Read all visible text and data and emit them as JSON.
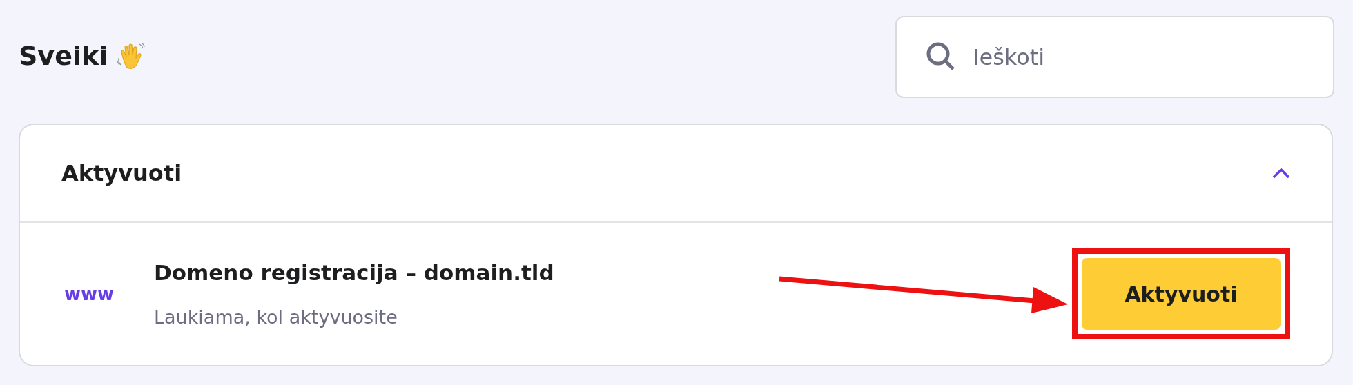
{
  "greeting": "Sveiki",
  "search": {
    "placeholder": "Ieškoti"
  },
  "section": {
    "title": "Aktyvuoti",
    "expanded": true,
    "items": [
      {
        "icon_text": "www",
        "title": "Domeno registracija – domain.tld",
        "subtitle": "Laukiama, kol aktyvuosite",
        "button": "Aktyvuoti",
        "highlighted": true
      }
    ]
  }
}
